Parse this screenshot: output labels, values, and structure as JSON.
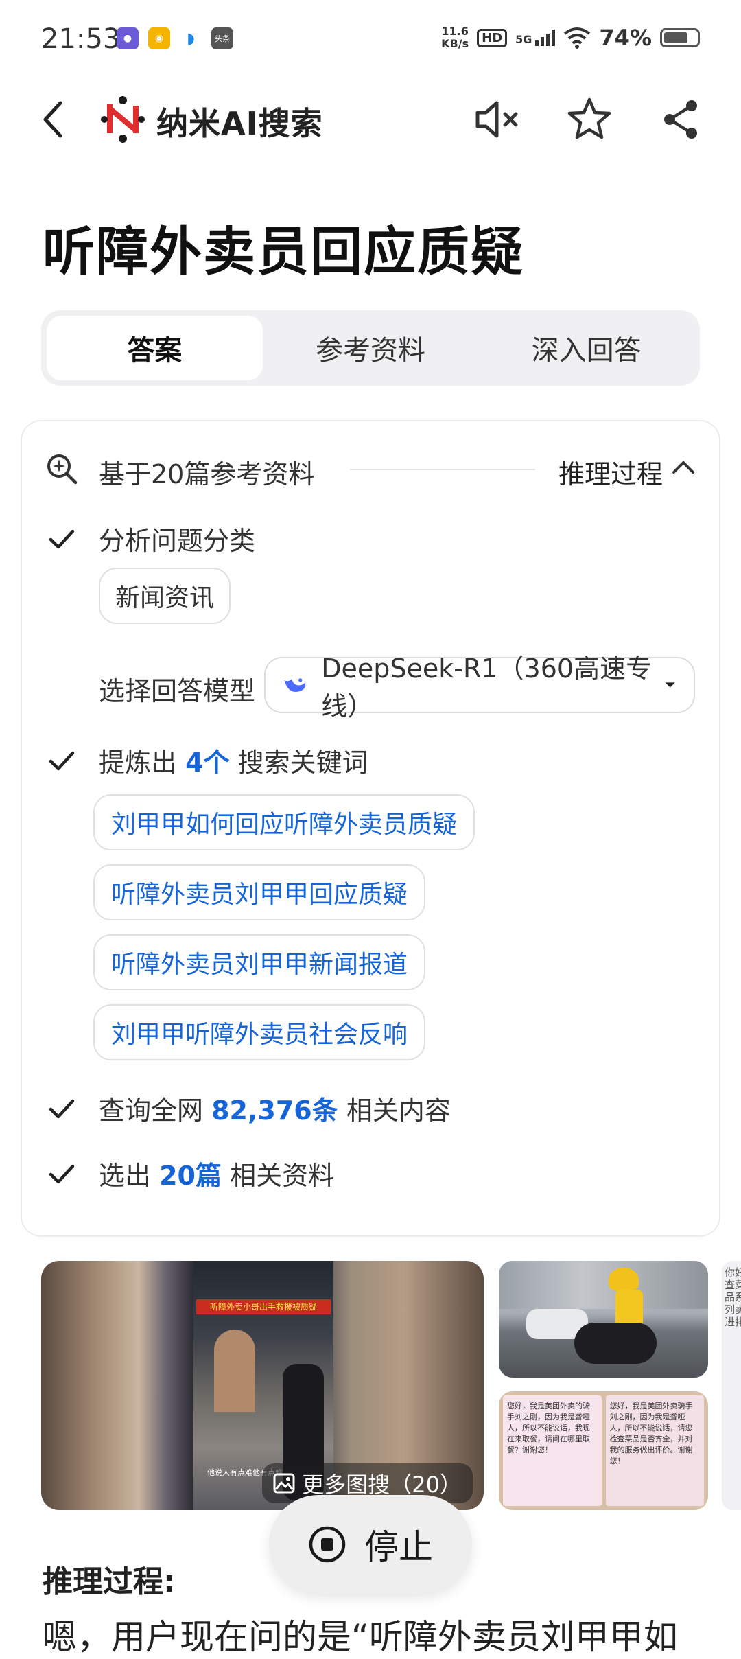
{
  "status_bar": {
    "time": "21:53",
    "net_speed_value": "11.6",
    "net_speed_unit": "KB/s",
    "hd": "HD",
    "network": "5G",
    "battery": "74%",
    "battery_level": 0.74,
    "app_icons": [
      "app-icon",
      "weibo-icon",
      "app-icon",
      "toutiao-icon"
    ],
    "toutiao_label": "头条"
  },
  "header": {
    "app_name": "纳米AI搜索",
    "icons": [
      "back-icon",
      "mute-icon",
      "star-icon",
      "share-icon"
    ]
  },
  "page_title": "听障外卖员回应质疑",
  "tabs": [
    {
      "label": "答案",
      "active": true
    },
    {
      "label": "参考资料",
      "active": false
    },
    {
      "label": "深入回答",
      "active": false
    }
  ],
  "card": {
    "sources_label": "基于20篇参考资料",
    "reasoning_toggle": "推理过程",
    "step1": {
      "label": "分析问题分类",
      "chip": "新闻资讯"
    },
    "model": {
      "label": "选择回答模型",
      "value": "DeepSeek-R1（360高速专线）"
    },
    "step2": {
      "prefix": "提炼出",
      "count": "4个",
      "suffix": "搜索关键词"
    },
    "keywords": [
      "刘甲甲如何回应听障外卖员质疑",
      "听障外卖员刘甲甲回应质疑",
      "听障外卖员刘甲甲新闻报道",
      "刘甲甲听障外卖员社会反响"
    ],
    "step3": {
      "prefix": "查询全网",
      "count": "82,376条",
      "suffix": "相关内容"
    },
    "step4": {
      "prefix": "选出",
      "count": "20篇",
      "suffix": "相关资料"
    }
  },
  "images": {
    "more_label": "更多图搜（20）",
    "main_banner": "听障外卖小哥出手救援被质疑",
    "main_caption": "他说人有点难他有点难",
    "note_left": "您好，我是美团外卖的骑手刘之刚，因为我是聋哑人，所以不能说话，我现在来取餐，请问在哪里取餐？谢谢您！",
    "note_right": "您好，我是美团外卖骑手刘之刚，因为我是聋哑人，所以不能说话，请您检查菜品是否齐全，并对我的服务做出评价。谢谢您！",
    "side_text": "你好查菜品系列卖进排"
  },
  "stop_button": "停止",
  "reasoning": {
    "title": "推理过程:",
    "text": "嗯，用户现在问的是“听障外卖员刘甲甲如"
  },
  "colors": {
    "accent_blue": "#1565d8",
    "logo_red": "#e02d2d",
    "logo_dark": "#1a1a1a"
  }
}
